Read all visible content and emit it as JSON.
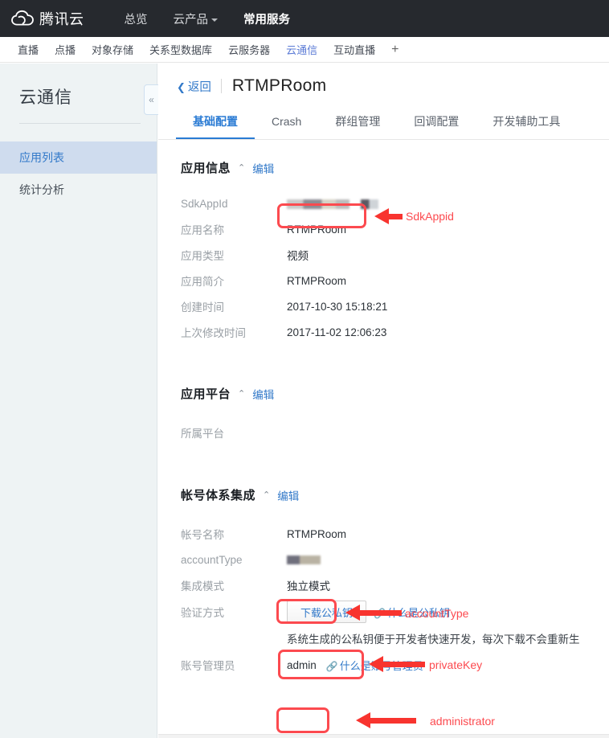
{
  "topnav": {
    "brand": "腾讯云",
    "logo_icon": "cloud-logo-icon",
    "items": [
      {
        "label": "总览",
        "strong": false,
        "has_caret": false
      },
      {
        "label": "云产品",
        "strong": false,
        "has_caret": true
      },
      {
        "label": "常用服务",
        "strong": true,
        "has_caret": false
      }
    ]
  },
  "subnav": {
    "items": [
      {
        "label": "直播",
        "active": false
      },
      {
        "label": "点播",
        "active": false
      },
      {
        "label": "对象存储",
        "active": false
      },
      {
        "label": "关系型数据库",
        "active": false
      },
      {
        "label": "云服务器",
        "active": false
      },
      {
        "label": "云通信",
        "active": true
      },
      {
        "label": "互动直播",
        "active": false
      }
    ],
    "add_label": "+"
  },
  "sidebar": {
    "title": "云通信",
    "collapse_icon": "«",
    "items": [
      {
        "label": "应用列表",
        "active": true
      },
      {
        "label": "统计分析",
        "active": false
      }
    ]
  },
  "header": {
    "back_label": "返回",
    "back_icon": "chevron-left-icon",
    "title": "RTMPRoom"
  },
  "tabs": [
    {
      "label": "基础配置",
      "active": true
    },
    {
      "label": "Crash",
      "active": false
    },
    {
      "label": "群组管理",
      "active": false
    },
    {
      "label": "回调配置",
      "active": false
    },
    {
      "label": "开发辅助工具",
      "active": false
    }
  ],
  "sections": {
    "app_info": {
      "title": "应用信息",
      "caret": "⌃",
      "edit_label": "编辑",
      "rows": [
        {
          "label": "SdkAppId",
          "value": "",
          "redacted": true
        },
        {
          "label": "应用名称",
          "value": "RTMPRoom"
        },
        {
          "label": "应用类型",
          "value": "视频"
        },
        {
          "label": "应用简介",
          "value": "RTMPRoom"
        },
        {
          "label": "创建时间",
          "value": "2017-10-30 15:18:21"
        },
        {
          "label": "上次修改时间",
          "value": "2017-11-02 12:06:23"
        }
      ]
    },
    "app_platform": {
      "title": "应用平台",
      "caret": "⌃",
      "edit_label": "编辑",
      "rows": [
        {
          "label": "所属平台",
          "value": ""
        }
      ]
    },
    "account_system": {
      "title": "帐号体系集成",
      "caret": "⌃",
      "edit_label": "编辑",
      "rows": {
        "account_name": {
          "label": "帐号名称",
          "value": "RTMPRoom"
        },
        "account_type": {
          "label": "accountType",
          "value": "",
          "redacted": true
        },
        "integration_mode": {
          "label": "集成模式",
          "value": "独立模式"
        },
        "auth_method": {
          "label": "验证方式",
          "button_label": "下载公私钥",
          "link_label": "什么是公私钥",
          "link_icon": "link-icon"
        },
        "auth_desc": "系统生成的公私钥便于开发者快速开发，每次下载不会重新生",
        "administrator": {
          "label": "账号管理员",
          "value": "admin",
          "link_label": "什么是账号管理员",
          "link_icon": "link-icon"
        }
      }
    }
  },
  "annotations": [
    {
      "label": "SdkAppid"
    },
    {
      "label": "privateKey"
    },
    {
      "label": "accountType"
    },
    {
      "label": "administrator"
    }
  ],
  "colors": {
    "annotation_red": "#fc4a4f",
    "arrow_red": "#f8342f",
    "link_blue": "#3279c9",
    "topnav_bg": "#26292e",
    "sidebar_bg": "#eef3f4",
    "sidebar_active_bg": "#cfdcee"
  }
}
